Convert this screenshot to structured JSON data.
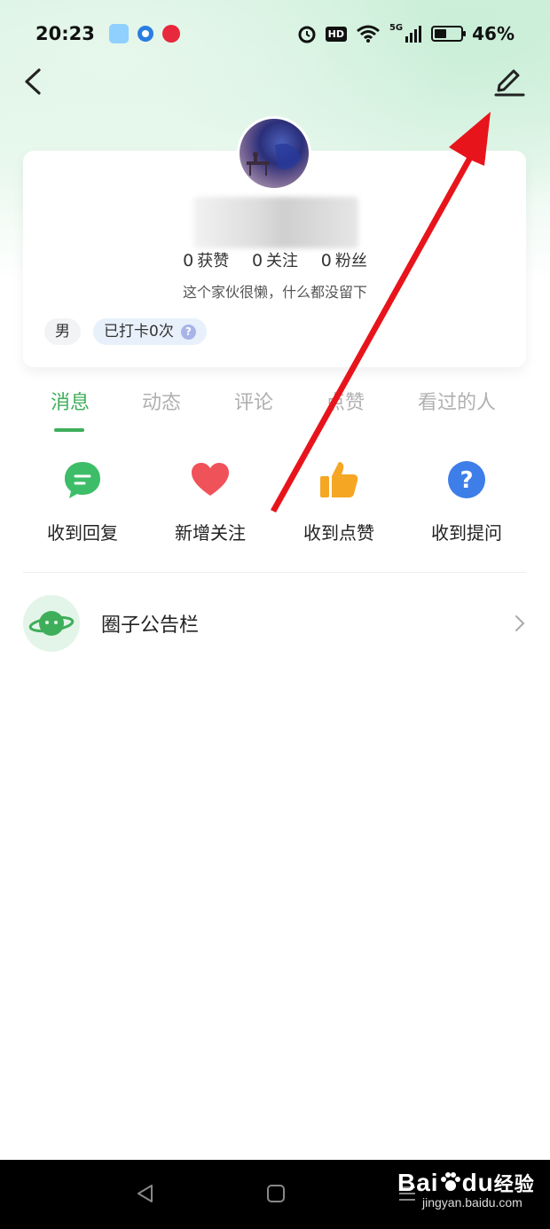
{
  "status_bar": {
    "time": "20:23",
    "hd": "HD",
    "network": "5G",
    "battery": "46%",
    "battery_level": 0.46
  },
  "profile": {
    "stats": [
      {
        "value": "0",
        "label": "获赞"
      },
      {
        "value": "0",
        "label": "关注"
      },
      {
        "value": "0",
        "label": "粉丝"
      }
    ],
    "bio": "这个家伙很懒，什么都没留下",
    "gender_tag": "男",
    "checkin_tag": "已打卡0次"
  },
  "tabs": [
    "消息",
    "动态",
    "评论",
    "点赞",
    "看过的人"
  ],
  "actions": [
    {
      "label": "收到回复",
      "icon": "chat-bubble-icon",
      "color": "#3dbd68"
    },
    {
      "label": "新增关注",
      "icon": "heart-icon",
      "color": "#f0525a"
    },
    {
      "label": "收到点赞",
      "icon": "thumbs-up-icon",
      "color": "#f5a623"
    },
    {
      "label": "收到提问",
      "icon": "question-icon",
      "color": "#3d7ee8"
    }
  ],
  "notice": {
    "label": "圈子公告栏",
    "icon": "planet-icon"
  },
  "watermark": {
    "brand_a": "Bai",
    "brand_b": "du",
    "brand_c": "经验",
    "url": "jingyan.baidu.com"
  },
  "colors": {
    "accent": "#3fae5b",
    "annotation_arrow": "#e8141c"
  }
}
